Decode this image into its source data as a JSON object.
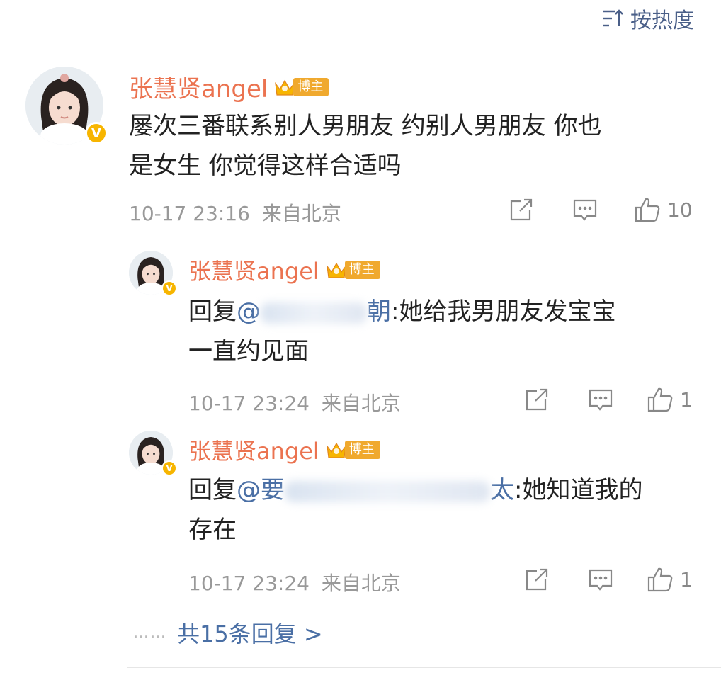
{
  "sort": {
    "label": "按热度",
    "icon": "sort-icon"
  },
  "comment": {
    "user": {
      "name": "张慧贤angel",
      "badge": "博主",
      "verified": "V"
    },
    "text_line1": "屡次三番联系别人男朋友 约别人男朋友 你也",
    "text_line2": "是女生 你觉得这样合适吗",
    "timestamp": "10-17 23:16",
    "location": "来自北京",
    "likes": "10"
  },
  "replies": [
    {
      "user": {
        "name": "张慧贤angel",
        "badge": "博主",
        "verified": "V"
      },
      "reply_prefix": "回复",
      "mention_start": "@",
      "mention_end": "朝",
      "text_after": ":她给我男朋友发宝宝",
      "text_line2": "一直约见面",
      "timestamp": "10-17 23:24",
      "location": "来自北京",
      "likes": "1"
    },
    {
      "user": {
        "name": "张慧贤angel",
        "badge": "博主",
        "verified": "V"
      },
      "reply_prefix": "回复",
      "mention_start": "@要",
      "mention_end": "太",
      "text_after": ":她知道我的",
      "text_line2": "存在",
      "timestamp": "10-17 23:24",
      "location": "来自北京",
      "likes": "1"
    }
  ],
  "more_replies": {
    "dots": "……",
    "label": "共15条回复 >"
  },
  "colors": {
    "name": "#eb7350",
    "link": "#4a6fa5",
    "meta": "#999999",
    "badge": "#f0a92e",
    "verified": "#f7b500"
  }
}
